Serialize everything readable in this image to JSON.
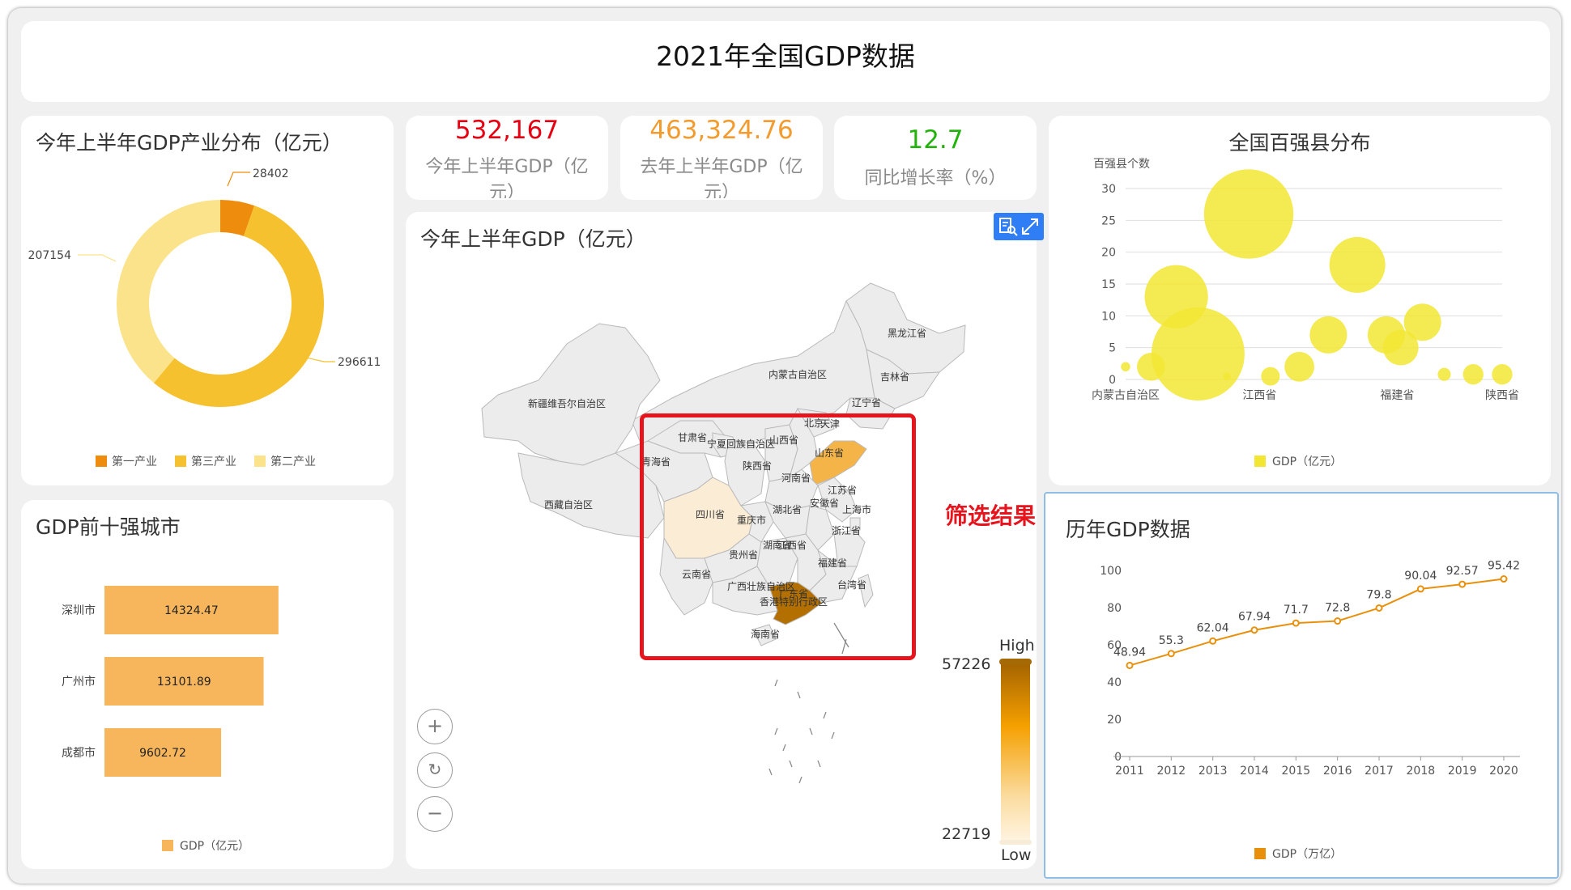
{
  "header": {
    "title": "2021年全国GDP数据"
  },
  "industry": {
    "title": "今年上半年GDP产业分布（亿元）",
    "colors": [
      "#ee8c0e",
      "#f5c12e",
      "#fae38a"
    ],
    "legend": [
      "第一产业",
      "第三产业",
      "第二产业"
    ],
    "values": [
      28402,
      296611,
      207154
    ]
  },
  "kpis": [
    {
      "value": "532,167",
      "label": "今年上半年GDP（亿元）",
      "color": "#e60012"
    },
    {
      "value": "463,324.76",
      "label": "去年上半年GDP（亿元）",
      "color": "#f29b2f"
    },
    {
      "value": "12.7",
      "label": "同比增长率（%）",
      "color": "#22b30b"
    }
  ],
  "map": {
    "title": "今年上半年GDP（亿元）",
    "toolbox": [
      "data-view",
      "fullscreen"
    ],
    "filter_label": "筛选结果",
    "visual_map": {
      "max": "57226",
      "min": "22719",
      "high": "High",
      "low": "Low"
    },
    "labels": [
      "黑龙江省",
      "吉林省",
      "辽宁省",
      "内蒙古自治区",
      "新疆维吾尔自治区",
      "甘肃省",
      "宁夏回族自治区",
      "北京",
      "天津",
      "山西省",
      "山东省",
      "陕西省",
      "青海省",
      "河南省",
      "江苏省",
      "安徽省",
      "上海市",
      "西藏自治区",
      "四川省",
      "重庆市",
      "湖北省",
      "浙江省",
      "江西省",
      "贵州省",
      "湖南省",
      "福建省",
      "云南省",
      "广西壮族自治区",
      "广东省",
      "台湾省",
      "香港特别行政区",
      "海南省"
    ],
    "highlighted": [
      "山东省",
      "四川省",
      "广东省"
    ]
  },
  "top10": {
    "title": "GDP前十强城市",
    "legend": "GDP（亿元）",
    "bar_color": "#f7b65c"
  },
  "counties": {
    "title": "全国百强县分布",
    "y_axis_name": "百强县个数",
    "legend": "GDP（亿元）",
    "color": "#f2e632"
  },
  "history": {
    "title": "历年GDP数据",
    "legend": "GDP（万亿）",
    "color": "#e8900c"
  },
  "chart_data": [
    {
      "type": "pie",
      "title": "今年上半年GDP产业分布（亿元）",
      "categories": [
        "第一产业",
        "第三产业",
        "第二产业"
      ],
      "values": [
        28402,
        296611,
        207154
      ]
    },
    {
      "type": "bar",
      "title": "GDP前十强城市",
      "categories": [
        "深圳市",
        "广州市",
        "成都市"
      ],
      "series": [
        {
          "name": "GDP（亿元）",
          "values": [
            14324.47,
            13101.89,
            9602.72
          ]
        }
      ],
      "xlim": [
        0,
        20000
      ]
    },
    {
      "type": "scatter",
      "title": "全国百强县分布",
      "ylabel": "百强县个数",
      "x_ticks": [
        "内蒙古自治区",
        "江西省",
        "福建省",
        "陕西省"
      ],
      "yticks": [
        0,
        5,
        10,
        15,
        20,
        25,
        30
      ],
      "ylim": [
        0,
        30
      ],
      "grid": true,
      "series": [
        {
          "name": "GDP（亿元）"
        }
      ],
      "points": [
        {
          "x": 0.0,
          "y": 2,
          "size": 0.5
        },
        {
          "x": 0.35,
          "y": 2,
          "size": 1.5
        },
        {
          "x": 0.7,
          "y": 13,
          "size": 3.4
        },
        {
          "x": 1.0,
          "y": 4,
          "size": 5.0
        },
        {
          "x": 1.4,
          "y": 0.5,
          "size": 0.4
        },
        {
          "x": 1.7,
          "y": 26,
          "size": 4.8
        },
        {
          "x": 2.0,
          "y": 0.5,
          "size": 1.0
        },
        {
          "x": 2.4,
          "y": 2,
          "size": 1.6
        },
        {
          "x": 2.8,
          "y": 7,
          "size": 2.0
        },
        {
          "x": 3.2,
          "y": 18,
          "size": 3.0
        },
        {
          "x": 3.6,
          "y": 7,
          "size": 2.0
        },
        {
          "x": 3.8,
          "y": 5,
          "size": 1.9
        },
        {
          "x": 4.1,
          "y": 9,
          "size": 2.0
        },
        {
          "x": 4.4,
          "y": 0.8,
          "size": 0.7
        },
        {
          "x": 4.8,
          "y": 0.8,
          "size": 1.1
        },
        {
          "x": 5.2,
          "y": 0.8,
          "size": 1.1
        }
      ]
    },
    {
      "type": "line",
      "title": "历年GDP数据",
      "x": [
        "2011",
        "2012",
        "2013",
        "2014",
        "2015",
        "2016",
        "2017",
        "2018",
        "2019",
        "2020"
      ],
      "series": [
        {
          "name": "GDP（万亿）",
          "values": [
            48.94,
            55.3,
            62.04,
            67.94,
            71.7,
            72.8,
            79.8,
            90.04,
            92.57,
            95.42
          ]
        }
      ],
      "ylim": [
        0,
        100
      ],
      "yticks": [
        0,
        20,
        40,
        60,
        80,
        100
      ]
    }
  ]
}
